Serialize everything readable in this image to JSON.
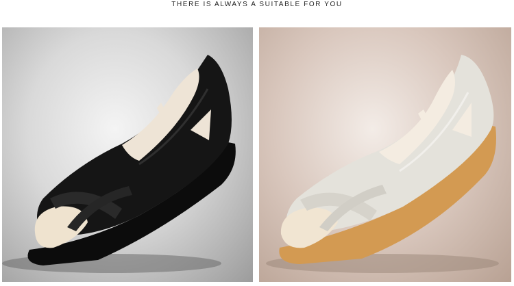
{
  "heading": "THERE IS ALWAYS A SUITABLE FOR YOU",
  "products": [
    {
      "name": "black-leather-peep-toe-flat",
      "color": "#111111",
      "sole": "#0a0a0a",
      "lining": "#f1e8dc"
    },
    {
      "name": "white-leather-peep-toe-flat",
      "color": "#e8e6df",
      "sole": "#d59a4e",
      "lining": "#f4ebe0"
    }
  ]
}
